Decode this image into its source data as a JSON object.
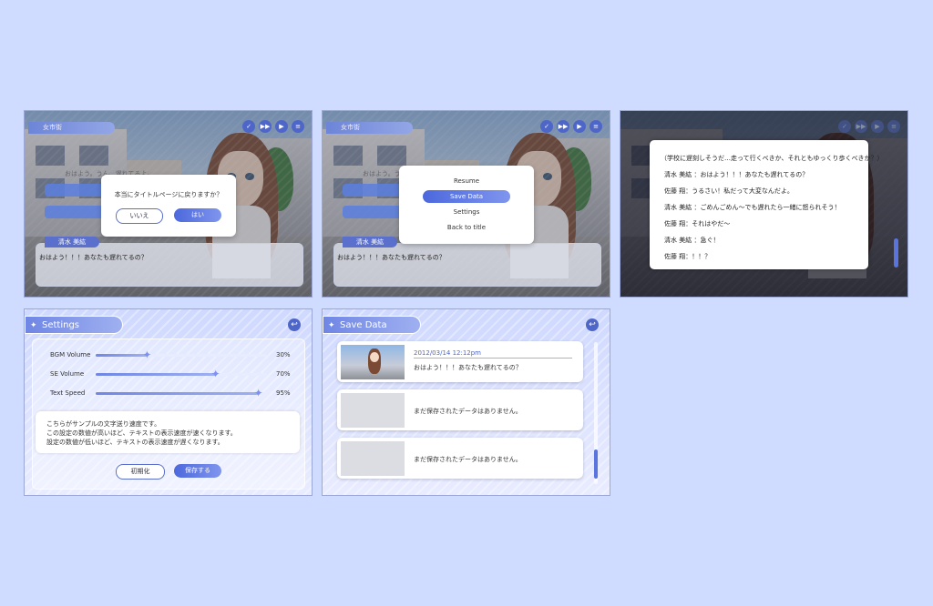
{
  "hud": {
    "name_tag": "女市街",
    "icon_check": "✓",
    "icon_skip": "▶▶",
    "icon_auto": "▶",
    "icon_menu": "≡"
  },
  "scene": {
    "speaker": "清水 美紘",
    "message": "おはよう！！！あなたも遅れてるの？",
    "bg_line": "おはよう。うん、遅れてるよ。"
  },
  "confirm_dialog": {
    "question": "本当にタイトルページに戻りますか？",
    "no_label": "いいえ",
    "yes_label": "はい"
  },
  "pause_menu": {
    "items": [
      "Resume",
      "Save Data",
      "Settings",
      "Back to title"
    ]
  },
  "backlog": {
    "lines": [
      "（学校に遅刻しそうだ…走って行くべきか、それともゆっくり歩くべきか？）",
      "清水 美紘 ：おはよう！！！あなたも遅れてるの？",
      "佐藤 翔：うるさい！私だって大変なんだよ。",
      "清水 美紘 ：ごめんごめん〜でも遅れたら一緒に怒られそう！",
      "佐藤 翔：それはやだ〜",
      "清水 美紘 ：急ぐ！",
      "佐藤 翔：！！？"
    ]
  },
  "settings": {
    "title": "Settings",
    "back_icon": "↩",
    "sliders": [
      {
        "label": "BGM Volume",
        "value": 30,
        "value_label": "30%"
      },
      {
        "label": "SE Volume",
        "value": 70,
        "value_label": "70%"
      },
      {
        "label": "Text Speed",
        "value": 95,
        "value_label": "95%"
      }
    ],
    "info_lines": [
      "こちらがサンプルの文字送り速度です。",
      "この設定の数値が高いほど、テキストの表示速度が速くなります。",
      "設定の数値が低いほど、テキストの表示速度が遅くなります。"
    ],
    "reset_label": "初期化",
    "save_label": "保存する"
  },
  "save_data": {
    "title": "Save Data",
    "back_icon": "↩",
    "slots": [
      {
        "date": "2012/03/14  12:12pm",
        "text": "おはよう！！！あなたも遅れてるの？"
      },
      {
        "date": "",
        "text": "まだ保存されたデータはありません。"
      },
      {
        "date": "",
        "text": "まだ保存されたデータはありません。"
      }
    ]
  },
  "colors": {
    "accent": "#4e66c7",
    "page_bg": "#cfdcff"
  }
}
